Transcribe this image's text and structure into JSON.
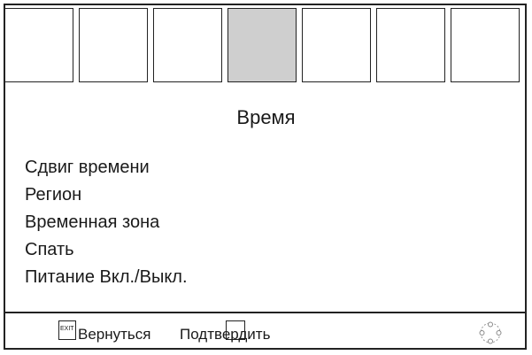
{
  "tabs": [
    {
      "id": "tab-1",
      "active": false
    },
    {
      "id": "tab-2",
      "active": false
    },
    {
      "id": "tab-3",
      "active": false
    },
    {
      "id": "tab-4",
      "active": true
    },
    {
      "id": "tab-5",
      "active": false
    },
    {
      "id": "tab-6",
      "active": false
    },
    {
      "id": "tab-7",
      "active": false
    }
  ],
  "title": "Время",
  "menu": [
    "Сдвиг времени",
    "Регион",
    "Временная зона",
    "Спать",
    "Питание Вкл./Выкл."
  ],
  "footer": {
    "exit_key": "EXIT",
    "back_label": "Вернуться",
    "confirm_label": "Подтвердить",
    "nav_icon": "dpad-icon"
  },
  "colors": {
    "active_tab": "#cfcfcf",
    "border": "#222222"
  }
}
